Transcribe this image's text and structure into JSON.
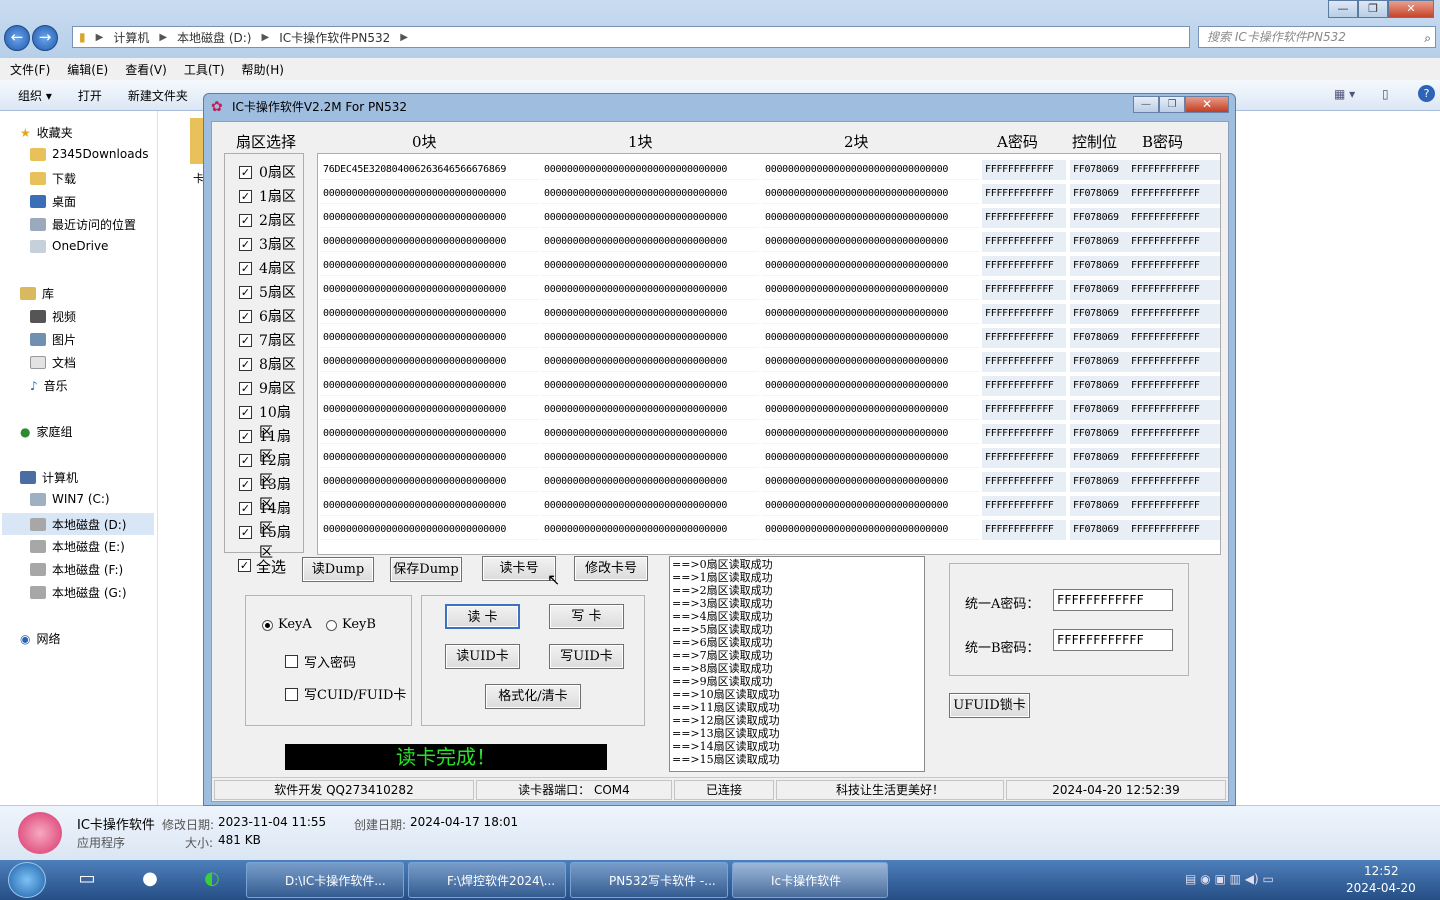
{
  "explorer": {
    "window_controls": [
      "—",
      "❐",
      "✕"
    ],
    "path": [
      "计算机",
      "本地磁盘 (D:)",
      "IC卡操作软件PN532"
    ],
    "search_placeholder": "搜索 IC卡操作软件PN532",
    "menus": [
      "文件(F)",
      "编辑(E)",
      "查看(V)",
      "工具(T)",
      "帮助(H)"
    ],
    "toolbar": {
      "organize": "组织 ▾",
      "open": "打开",
      "new_folder": "新建文件夹"
    },
    "sidebar": {
      "favorites": "收藏夹",
      "fav_items": [
        "2345Downloads",
        "下载",
        "桌面",
        "最近访问的位置",
        "OneDrive"
      ],
      "library": "库",
      "lib_items": [
        "视频",
        "图片",
        "文档",
        "音乐"
      ],
      "homegroup": "家庭组",
      "computer": "计算机",
      "drives": [
        "WIN7 (C:)",
        "本地磁盘 (D:)",
        "本地磁盘 (E:)",
        "本地磁盘 (F:)",
        "本地磁盘 (G:)"
      ],
      "network": "网络"
    },
    "details": {
      "name": "IC卡操作软件",
      "modified_label": "修改日期:",
      "modified": "2023-11-04 11:55",
      "created_label": "创建日期:",
      "created": "2024-04-17 18:01",
      "type": "应用程序",
      "size_label": "大小:",
      "size": "481 KB"
    },
    "partial_file_label": "卡"
  },
  "taskbar": {
    "tasks": [
      "D:\\IC卡操作软件...",
      "F:\\焊控软件2024\\...",
      "PN532写卡软件 -...",
      "Ic卡操作软件"
    ],
    "clock_time": "12:52",
    "clock_date": "2024-04-20"
  },
  "app": {
    "title": "IC卡操作软件V2.2M For PN532",
    "headers": {
      "sector": "扇区选择",
      "b0": "0块",
      "b1": "1块",
      "b2": "2块",
      "keya": "A密码",
      "ctrl": "控制位",
      "keyb": "B密码"
    },
    "sectors": [
      "0扇区",
      "1扇区",
      "2扇区",
      "3扇区",
      "4扇区",
      "5扇区",
      "6扇区",
      "7扇区",
      "8扇区",
      "9扇区",
      "10扇区",
      "11扇区",
      "12扇区",
      "13扇区",
      "14扇区",
      "15扇区"
    ],
    "rows": [
      [
        "76DEC45E320804006263646566676869",
        "00000000000000000000000000000000",
        "00000000000000000000000000000000",
        "FFFFFFFFFFFF",
        "FF078069",
        "FFFFFFFFFFFF"
      ],
      [
        "00000000000000000000000000000000",
        "00000000000000000000000000000000",
        "00000000000000000000000000000000",
        "FFFFFFFFFFFF",
        "FF078069",
        "FFFFFFFFFFFF"
      ],
      [
        "00000000000000000000000000000000",
        "00000000000000000000000000000000",
        "00000000000000000000000000000000",
        "FFFFFFFFFFFF",
        "FF078069",
        "FFFFFFFFFFFF"
      ],
      [
        "00000000000000000000000000000000",
        "00000000000000000000000000000000",
        "00000000000000000000000000000000",
        "FFFFFFFFFFFF",
        "FF078069",
        "FFFFFFFFFFFF"
      ],
      [
        "00000000000000000000000000000000",
        "00000000000000000000000000000000",
        "00000000000000000000000000000000",
        "FFFFFFFFFFFF",
        "FF078069",
        "FFFFFFFFFFFF"
      ],
      [
        "00000000000000000000000000000000",
        "00000000000000000000000000000000",
        "00000000000000000000000000000000",
        "FFFFFFFFFFFF",
        "FF078069",
        "FFFFFFFFFFFF"
      ],
      [
        "00000000000000000000000000000000",
        "00000000000000000000000000000000",
        "00000000000000000000000000000000",
        "FFFFFFFFFFFF",
        "FF078069",
        "FFFFFFFFFFFF"
      ],
      [
        "00000000000000000000000000000000",
        "00000000000000000000000000000000",
        "00000000000000000000000000000000",
        "FFFFFFFFFFFF",
        "FF078069",
        "FFFFFFFFFFFF"
      ],
      [
        "00000000000000000000000000000000",
        "00000000000000000000000000000000",
        "00000000000000000000000000000000",
        "FFFFFFFFFFFF",
        "FF078069",
        "FFFFFFFFFFFF"
      ],
      [
        "00000000000000000000000000000000",
        "00000000000000000000000000000000",
        "00000000000000000000000000000000",
        "FFFFFFFFFFFF",
        "FF078069",
        "FFFFFFFFFFFF"
      ],
      [
        "00000000000000000000000000000000",
        "00000000000000000000000000000000",
        "00000000000000000000000000000000",
        "FFFFFFFFFFFF",
        "FF078069",
        "FFFFFFFFFFFF"
      ],
      [
        "00000000000000000000000000000000",
        "00000000000000000000000000000000",
        "00000000000000000000000000000000",
        "FFFFFFFFFFFF",
        "FF078069",
        "FFFFFFFFFFFF"
      ],
      [
        "00000000000000000000000000000000",
        "00000000000000000000000000000000",
        "00000000000000000000000000000000",
        "FFFFFFFFFFFF",
        "FF078069",
        "FFFFFFFFFFFF"
      ],
      [
        "00000000000000000000000000000000",
        "00000000000000000000000000000000",
        "00000000000000000000000000000000",
        "FFFFFFFFFFFF",
        "FF078069",
        "FFFFFFFFFFFF"
      ],
      [
        "00000000000000000000000000000000",
        "00000000000000000000000000000000",
        "00000000000000000000000000000000",
        "FFFFFFFFFFFF",
        "FF078069",
        "FFFFFFFFFFFF"
      ],
      [
        "00000000000000000000000000000000",
        "00000000000000000000000000000000",
        "00000000000000000000000000000000",
        "FFFFFFFFFFFF",
        "FF078069",
        "FFFFFFFFFFFF"
      ]
    ],
    "select_all": "全选",
    "buttons": {
      "read_dump": "读Dump",
      "save_dump": "保存Dump",
      "read_card_no": "读卡号",
      "modify_card_no": "修改卡号",
      "read_card": "读  卡",
      "write_card": "写  卡",
      "read_uid": "读UID卡",
      "write_uid": "写UID卡",
      "format": "格式化/清卡",
      "ufuid_lock": "UFUID锁卡"
    },
    "options": {
      "keya": "KeyA",
      "keyb": "KeyB",
      "write_key": "写入密码",
      "write_cuid": "写CUID/FUID卡"
    },
    "status_message": "读卡完成！",
    "status_color": "#29e329",
    "log": [
      "==>0扇区读取成功",
      "==>1扇区读取成功",
      "==>2扇区读取成功",
      "==>3扇区读取成功",
      "==>4扇区读取成功",
      "==>5扇区读取成功",
      "==>6扇区读取成功",
      "==>7扇区读取成功",
      "==>8扇区读取成功",
      "==>9扇区读取成功",
      "==>10扇区读取成功",
      "==>11扇区读取成功",
      "==>12扇区读取成功",
      "==>13扇区读取成功",
      "==>14扇区读取成功",
      "==>15扇区读取成功"
    ],
    "unified": {
      "a_label": "统一A密码：",
      "a_value": "FFFFFFFFFFFF",
      "b_label": "统一B密码：",
      "b_value": "FFFFFFFFFFFF"
    },
    "statusbar": [
      "软件开发  QQ273410282",
      "读卡器端口： COM4",
      "已连接",
      "科技让生活更美好！",
      "2024-04-20 12:52:39"
    ]
  }
}
